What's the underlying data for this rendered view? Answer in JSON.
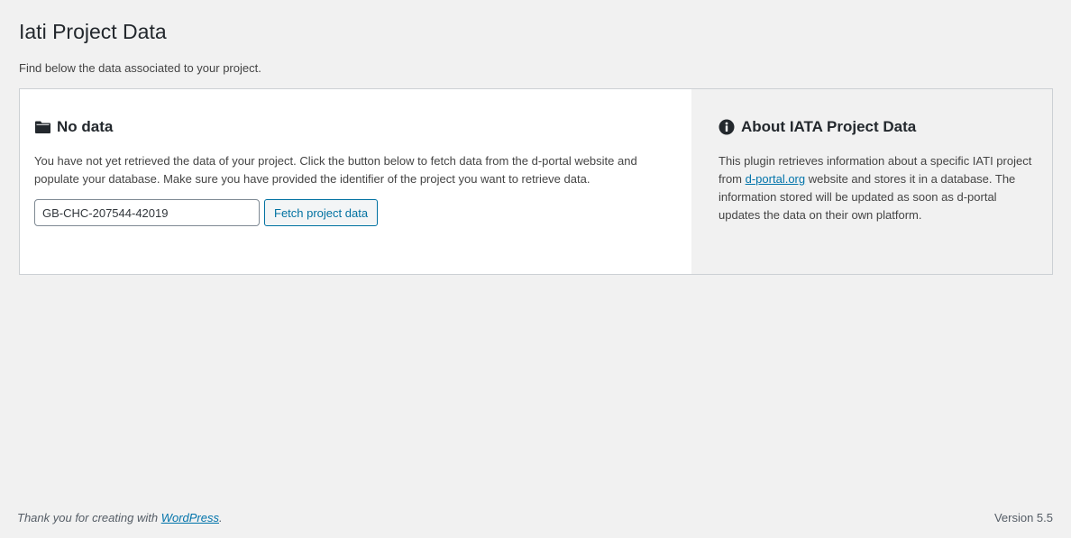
{
  "page": {
    "title": "Iati Project Data",
    "intro": "Find below the data associated to your project."
  },
  "no_data": {
    "icon": "folder-icon",
    "title": "No data",
    "description": "You have not yet retrieved the data of your project. Click the button below to fetch data from the d-portal website and populate your database. Make sure you have provided the identifier of the project you want to retrieve data.",
    "identifier_value": "GB-CHC-207544-42019",
    "fetch_button_label": "Fetch project data"
  },
  "about": {
    "icon": "info-icon",
    "title": "About IATA Project Data",
    "text_before_link": "This plugin retrieves information about a specific IATI project from ",
    "link_text": "d-portal.org",
    "text_after_link": " website and stores it in a database. The information stored will be updated as soon as d-portal updates the data on their own platform."
  },
  "footer": {
    "thanks_prefix": "Thank you for creating with ",
    "thanks_link": "WordPress",
    "thanks_suffix": ".",
    "version": "Version 5.5"
  },
  "colors": {
    "accent": "#0073aa",
    "background": "#f1f1f1",
    "panel": "#ffffff"
  }
}
